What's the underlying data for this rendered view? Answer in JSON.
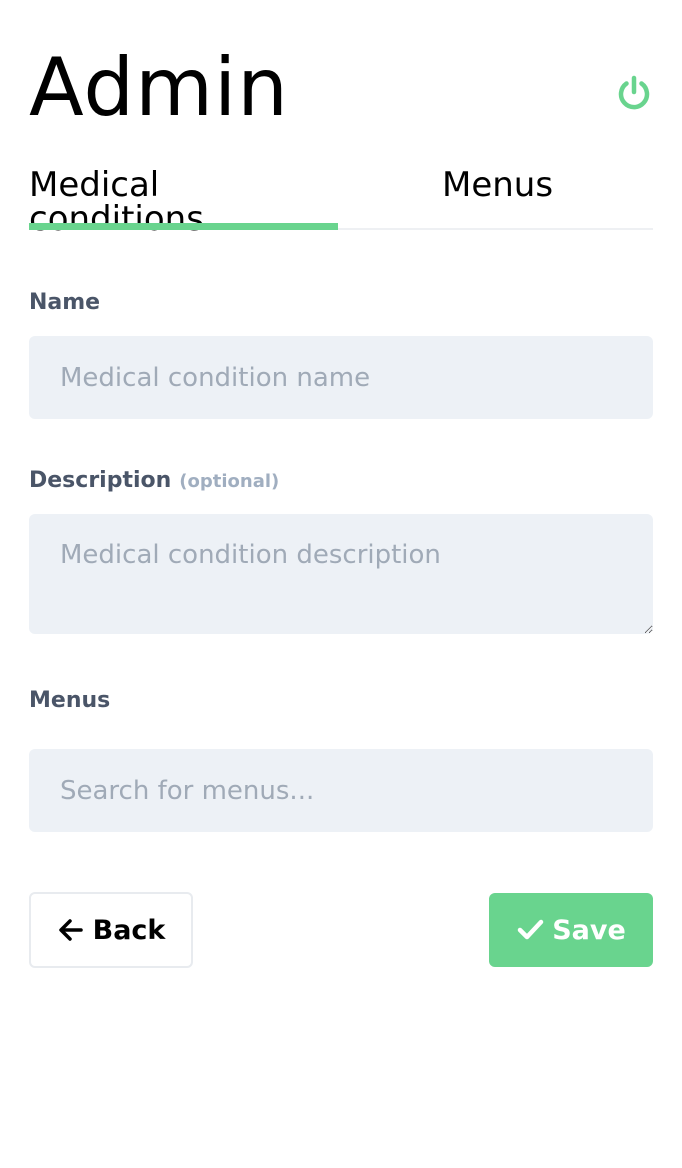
{
  "header": {
    "title": "Admin",
    "power_icon": "power-icon"
  },
  "tabs": [
    {
      "label": "Medical conditions",
      "active": true
    },
    {
      "label": "Menus",
      "active": false
    }
  ],
  "form": {
    "name": {
      "label": "Name",
      "value": "",
      "placeholder": "Medical condition name"
    },
    "description": {
      "label": "Description",
      "optional_label": "(optional)",
      "value": "",
      "placeholder": "Medical condition description"
    },
    "menus": {
      "label": "Menus",
      "value": "",
      "placeholder": "Search for menus..."
    }
  },
  "actions": {
    "back_label": "Back",
    "back_icon": "arrow-left-icon",
    "save_label": "Save",
    "save_icon": "check-icon"
  },
  "colors": {
    "accent": "#69d48e",
    "field_bg": "#edf1f6",
    "label": "#4a5568",
    "placeholder": "#a0aab7",
    "optional": "#a0aec0"
  }
}
